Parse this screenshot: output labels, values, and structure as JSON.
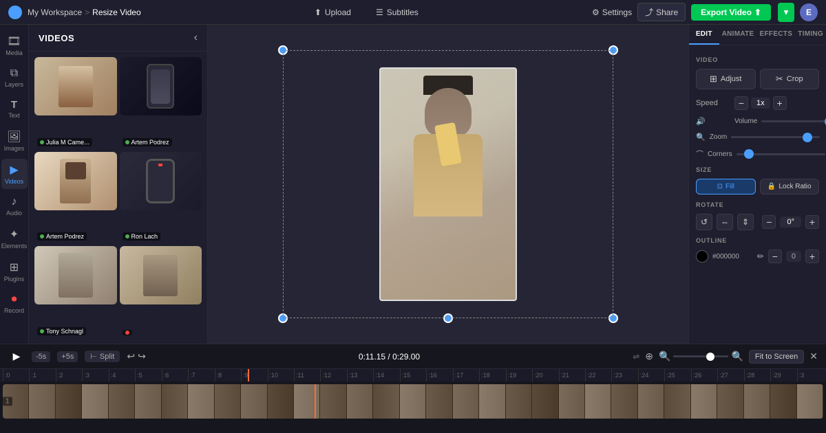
{
  "app": {
    "logo_letter": "E",
    "workspace": "My Workspace",
    "breadcrumb_separator": ">",
    "page_title": "Resize Video"
  },
  "topbar": {
    "upload_label": "Upload",
    "subtitles_label": "Subtitles",
    "settings_label": "Settings",
    "share_label": "Share",
    "export_label": "Export Video"
  },
  "sidebar": {
    "items": [
      {
        "id": "media",
        "label": "Media",
        "icon": "🎞"
      },
      {
        "id": "layers",
        "label": "Layers",
        "icon": "⧉"
      },
      {
        "id": "text",
        "label": "Text",
        "icon": "T"
      },
      {
        "id": "images",
        "label": "Images",
        "icon": "🖼"
      },
      {
        "id": "videos",
        "label": "Videos",
        "icon": "▶"
      },
      {
        "id": "audio",
        "label": "Audio",
        "icon": "♪"
      },
      {
        "id": "elements",
        "label": "Elements",
        "icon": "✦"
      },
      {
        "id": "plugins",
        "label": "Plugins",
        "icon": "⊞"
      },
      {
        "id": "record",
        "label": "Record",
        "icon": "⏺"
      }
    ],
    "active": "videos"
  },
  "media_panel": {
    "title": "VIDEOS",
    "videos": [
      {
        "id": 1,
        "name": "Julia M Came...",
        "status": "green",
        "class": "thumb1"
      },
      {
        "id": 2,
        "name": "Artem Podrez",
        "status": "green",
        "class": "thumb2"
      },
      {
        "id": 3,
        "name": "Artem Podrez",
        "status": "green",
        "class": "thumb3"
      },
      {
        "id": 4,
        "name": "Ron Lach",
        "status": "green",
        "class": "thumb4"
      },
      {
        "id": 5,
        "name": "Tony Schnagl",
        "status": "green",
        "class": "thumb5"
      },
      {
        "id": 6,
        "name": "",
        "status": "red",
        "class": "thumb6"
      }
    ]
  },
  "right_panel": {
    "tabs": [
      "EDIT",
      "ANIMATE",
      "EFFECTS",
      "TIMING"
    ],
    "active_tab": "EDIT",
    "sections": {
      "video_label": "VIDEO",
      "adjust_label": "Adjust",
      "crop_label": "Crop",
      "speed_label": "Speed",
      "speed_value": "1x",
      "volume_label": "Volume",
      "zoom_label": "Zoom",
      "corners_label": "Corners",
      "size_label": "SIZE",
      "fill_label": "Fill",
      "lock_ratio_label": "Lock Ratio",
      "rotate_label": "ROTATE",
      "rotate_value": "0°",
      "outline_label": "OUTLINE",
      "outline_color": "#000000",
      "outline_value": "0"
    }
  },
  "timeline": {
    "play_icon": "▶",
    "skip_back_label": "-5s",
    "skip_fwd_label": "+5s",
    "split_label": "Split",
    "time_display": "0:11.15 / 0:29.00",
    "fit_label": "Fit to Screen",
    "ruler_marks": [
      ":0",
      ":1",
      ":2",
      ":3",
      ":4",
      ":5",
      ":6",
      ":7",
      ":8",
      ":9",
      ":10",
      ":11",
      ":12",
      ":13",
      ":14",
      ":15",
      ":16",
      ":17",
      ":18",
      ":19",
      ":20",
      ":21",
      ":22",
      ":23",
      ":24",
      ":25",
      ":26",
      ":27",
      ":28",
      ":29",
      ":3"
    ]
  }
}
